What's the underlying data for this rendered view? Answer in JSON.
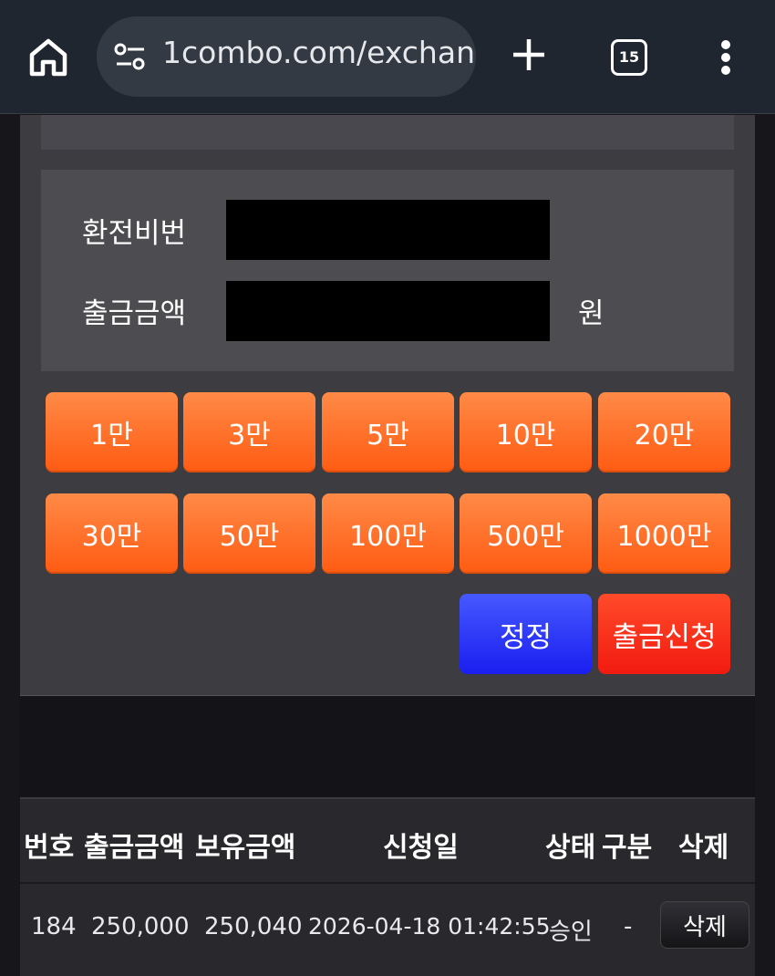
{
  "browser": {
    "url": "1combo.com/exchan",
    "tab_count": "15"
  },
  "form": {
    "password_label": "환전비번",
    "amount_label": "출금금액",
    "unit": "원"
  },
  "amount_buttons": [
    "1만",
    "3만",
    "5만",
    "10만",
    "20만",
    "30만",
    "50만",
    "100만",
    "500만",
    "1000만"
  ],
  "actions": {
    "reset": "정정",
    "apply": "출금신청"
  },
  "table": {
    "headers": [
      "번호",
      "출금금액",
      "보유금액",
      "신청일",
      "상태",
      "구분",
      "삭제"
    ],
    "rows": [
      {
        "no": "184",
        "amount": "250,000",
        "balance": "250,040",
        "date": "2026-04-18 01:42:55",
        "status": "승인",
        "type": "-",
        "delete": "삭제"
      }
    ]
  }
}
